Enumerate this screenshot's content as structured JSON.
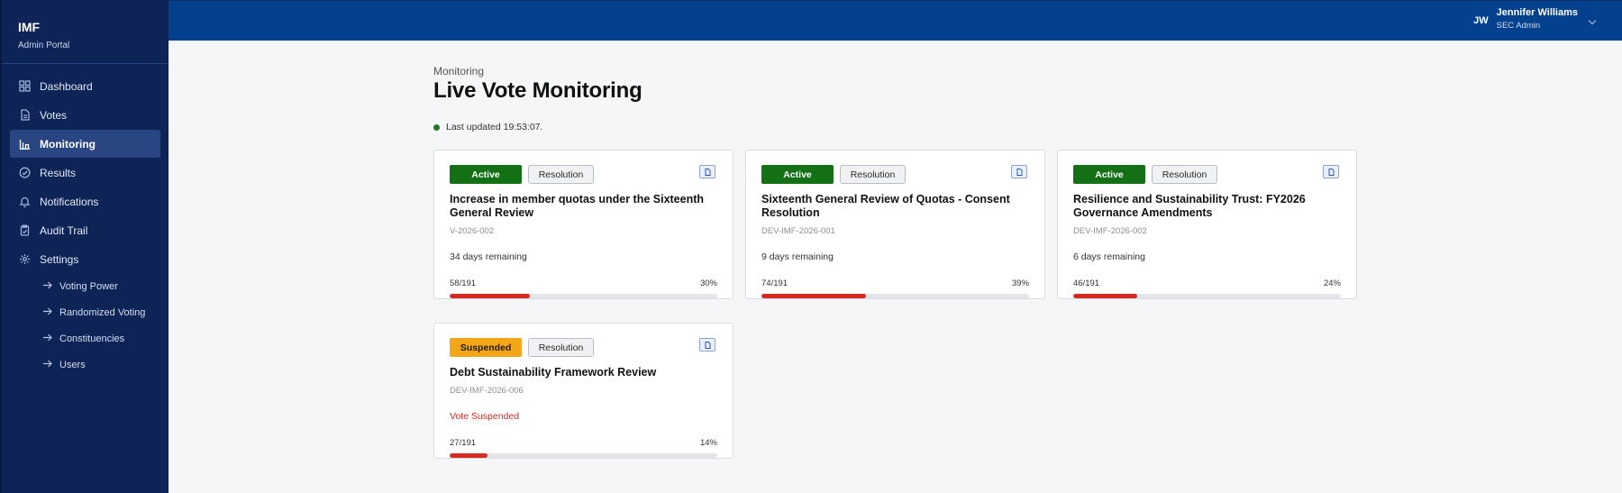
{
  "brand": {
    "title": "IMF",
    "subtitle": "Admin Portal"
  },
  "nav": [
    {
      "label": "Dashboard",
      "icon": "dashboard-grid-icon",
      "active": false
    },
    {
      "label": "Votes",
      "icon": "document-icon",
      "active": false
    },
    {
      "label": "Monitoring",
      "icon": "bar-chart-icon",
      "active": true
    },
    {
      "label": "Results",
      "icon": "check-circle-icon",
      "active": false
    },
    {
      "label": "Notifications",
      "icon": "bell-icon",
      "active": false
    },
    {
      "label": "Audit Trail",
      "icon": "clipboard-icon",
      "active": false
    },
    {
      "label": "Settings",
      "icon": "gear-icon",
      "active": false
    }
  ],
  "settings_sub": [
    "Voting Power",
    "Randomized Voting",
    "Constituencies",
    "Users"
  ],
  "user": {
    "initials": "JW",
    "name": "Jennifer Williams",
    "role": "SEC Admin"
  },
  "page": {
    "breadcrumb": "Monitoring",
    "title": "Live Vote Monitoring",
    "last_updated": "Last updated 19:53:07."
  },
  "status_colors": {
    "active": "#137014",
    "suspended": "#f2a618",
    "progress": "#d42a1f"
  },
  "votes": [
    {
      "status": "Active",
      "type": "Resolution",
      "title": "Increase in member quotas under the Sixteenth General Review",
      "id": "V-2026-002",
      "remaining": "34 days remaining",
      "count": "58/191",
      "percent_label": "30%",
      "percent": 30
    },
    {
      "status": "Active",
      "type": "Resolution",
      "title": "Sixteenth General Review of Quotas - Consent Resolution",
      "id": "DEV-IMF-2026-001",
      "remaining": "9 days remaining",
      "count": "74/191",
      "percent_label": "39%",
      "percent": 39
    },
    {
      "status": "Active",
      "type": "Resolution",
      "title": "Resilience and Sustainability Trust: FY2026 Governance Amendments",
      "id": "DEV-IMF-2026-002",
      "remaining": "6 days remaining",
      "count": "46/191",
      "percent_label": "24%",
      "percent": 24
    },
    {
      "status": "Suspended",
      "type": "Resolution",
      "title": "Debt Sustainability Framework Review",
      "id": "DEV-IMF-2026-006",
      "remaining": "Vote Suspended",
      "count": "27/191",
      "percent_label": "14%",
      "percent": 14
    }
  ]
}
